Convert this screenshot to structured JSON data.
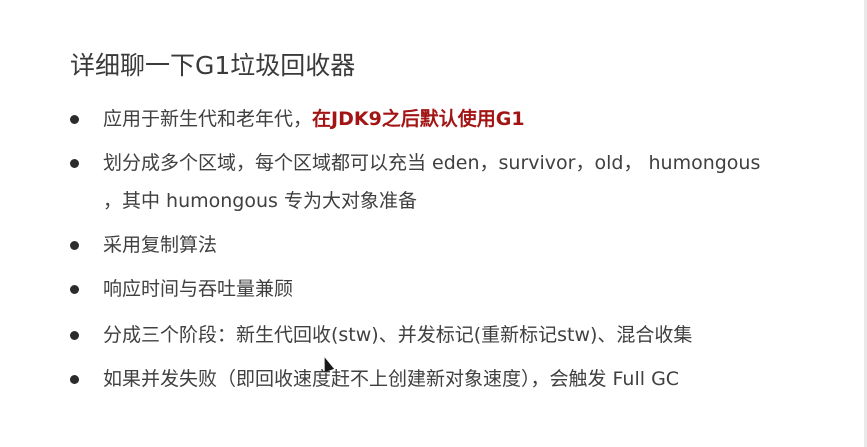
{
  "slide": {
    "title": "详细聊一下G1垃圾回收器",
    "bullets": [
      {
        "text": "应用于新生代和老年代，",
        "highlight": "在JDK9之后默认使用G1"
      },
      {
        "text": "划分成多个区域，每个区域都可以充当 eden，survivor，old， humongous",
        "continuation": "，其中 humongous 专为大对象准备"
      },
      {
        "text": "采用复制算法"
      },
      {
        "text": "响应时间与吞吐量兼顾"
      },
      {
        "text": "分成三个阶段：新生代回收(stw)、并发标记(重新标记stw)、混合收集"
      },
      {
        "text": "如果并发失败（即回收速度赶不上创建新对象速度），会触发 Full GC"
      }
    ]
  },
  "colors": {
    "text": "#404040",
    "highlight": "#a31515",
    "background": "#ffffff"
  }
}
